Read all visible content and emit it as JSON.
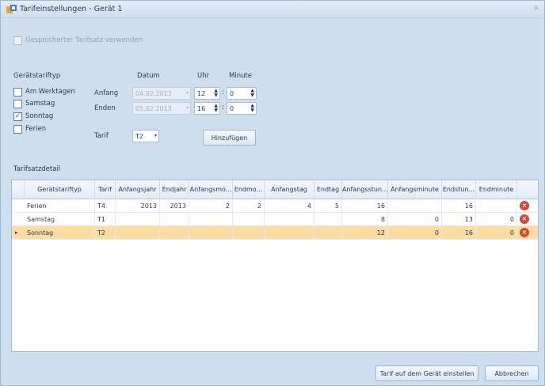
{
  "window": {
    "title": "Tarifeinstellungen  -  Gerät 1",
    "close": "×"
  },
  "use_saved": {
    "label": "Gespeicherter Tarifsatz verwenden",
    "checked": false
  },
  "device_type": {
    "header": "Gerätstariftyp",
    "options": [
      {
        "label": "Am Werktagen",
        "checked": false
      },
      {
        "label": "Samstag",
        "checked": false
      },
      {
        "label": "Sonntag",
        "checked": true
      },
      {
        "label": "Ferien",
        "checked": false
      }
    ]
  },
  "col_headers": {
    "datum": "Datum",
    "uhr": "Uhr",
    "minute": "Minute"
  },
  "start": {
    "label": "Anfang",
    "date": "04.02.2013",
    "hour": "12",
    "minute": "0"
  },
  "end": {
    "label": "Enden",
    "date": "05.02.2013",
    "hour": "16",
    "minute": "0"
  },
  "tariff": {
    "label": "Tarif",
    "value": "T2"
  },
  "add_button": "Hinzufügen",
  "detail": {
    "header": "Tarifsatzdetail",
    "columns": [
      "Gerätstariftyp",
      "Tarif",
      "Anfangsjahr",
      "Endjahr",
      "Anfangsmo...",
      "Endmo...",
      "Anfangstag",
      "Endtag",
      "Anfangsstun...",
      "Anfangsminute",
      "Endstun...",
      "Endminute"
    ],
    "rows": [
      {
        "selected": false,
        "cells": [
          "Ferien",
          "T4",
          "2013",
          "2013",
          "2",
          "2",
          "4",
          "5",
          "16",
          "",
          "16",
          ""
        ]
      },
      {
        "selected": false,
        "cells": [
          "Samstag",
          "T1",
          "",
          "",
          "",
          "",
          "",
          "",
          "8",
          "0",
          "13",
          "0"
        ]
      },
      {
        "selected": true,
        "cells": [
          "Sonntag",
          "T2",
          "",
          "",
          "",
          "",
          "",
          "",
          "12",
          "0",
          "16",
          "0"
        ]
      }
    ]
  },
  "footer": {
    "apply": "Tarif auf dem Gerät einstellen",
    "cancel": "Abbrechen"
  },
  "icons": {
    "app": "app-icon",
    "delete": "delete-row-icon",
    "row_indicator": "current-row-icon",
    "spin": "spin-arrows-icon",
    "dropdown": "dropdown-arrow-icon"
  },
  "colors": {
    "background": "#cfdeee",
    "selected_row": "#fcdca1",
    "delete": "#e0452f",
    "check": "#2a8a2a"
  }
}
